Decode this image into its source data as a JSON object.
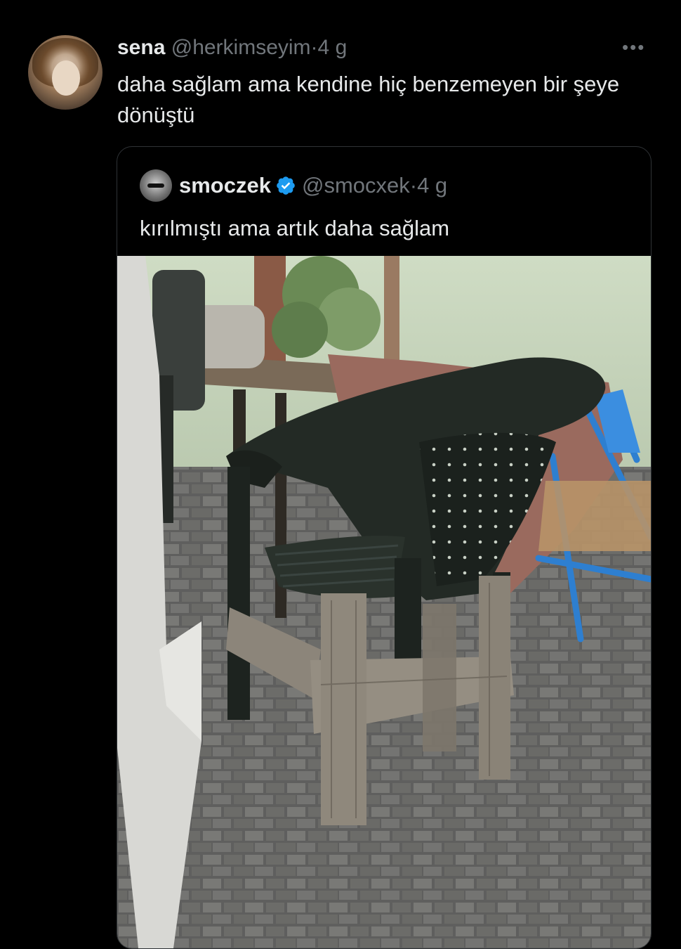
{
  "tweet": {
    "name": "sena",
    "handle": "@herkimseyim",
    "separator": "·",
    "time": "4 g",
    "text": "daha sağlam ama kendine hiç benzemeyen bir şeye dönüştü",
    "more_icon": "more-horizontal-icon"
  },
  "quoted": {
    "name": "smoczek",
    "verified": true,
    "handle": "@smocxek",
    "separator": "·",
    "time": "4 g",
    "text": "kırılmıştı ama artık daha sağlam",
    "media": "photo of a broken green plastic chair reinforced with wooden planks on a paved patio"
  },
  "colors": {
    "background": "#000000",
    "text_primary": "#e7e9ea",
    "text_secondary": "#71767b",
    "border": "#2f3336",
    "verified_blue": "#1d9bf0"
  }
}
